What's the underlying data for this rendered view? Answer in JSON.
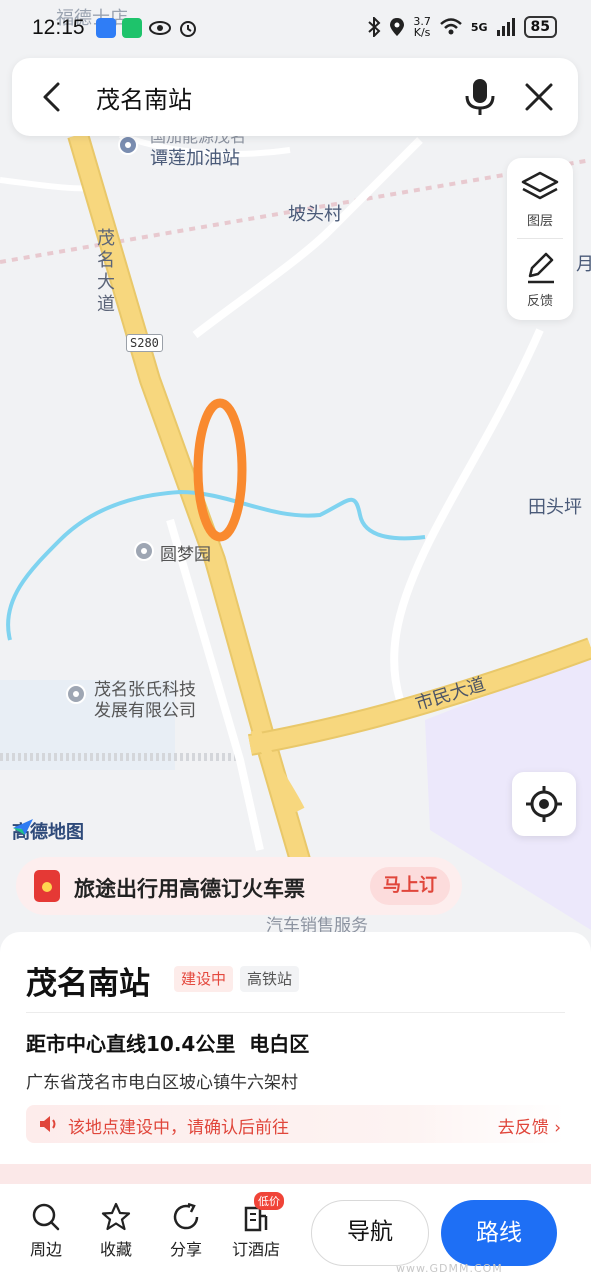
{
  "status_bar": {
    "time": "12:15",
    "speed_value": "3.7",
    "speed_unit": "K/s",
    "network": "5G",
    "battery": "85"
  },
  "search": {
    "query": "茂名南站"
  },
  "map": {
    "labels": {
      "gas_station_partial": "国加能源茂名",
      "gas_station": "谭莲加油站",
      "village_potou": "坡头村",
      "road_maoming_dadao": "茂名大道",
      "shield_s280": "S280",
      "poi_yuanmengyuan": "圆梦园",
      "village_tiantou": "田头坪",
      "poi_company_line1": "茂名张氏科技",
      "poi_company_line2": "发展有限公司",
      "road_shimin": "市民大道",
      "partial_service": "汽车销售服务",
      "top_partial": "福德士店",
      "edge_partial": "月"
    },
    "logo": "高德地图",
    "marker_color": "#f98a2f",
    "river_color": "#7fd3f0",
    "road_color": "#f7d77e"
  },
  "tools": {
    "layers": "图层",
    "feedback": "反馈"
  },
  "promo": {
    "text": "旅途出行用高德订火车票",
    "button": "马上订"
  },
  "poi": {
    "title": "茂名南站",
    "tag_status": "建设中",
    "tag_type": "高铁站",
    "distance": "距市中心直线10.4公里",
    "district": "电白区",
    "address": "广东省茂名市电白区坡心镇牛六架村",
    "warning": "该地点建设中，请确认后前往",
    "warning_link": "去反馈"
  },
  "bottom_bar": {
    "nearby": "周边",
    "favorite": "收藏",
    "share": "分享",
    "hotel": "订酒店",
    "hotel_badge": "低价",
    "navigate": "导航",
    "route": "路线"
  },
  "watermark": "www.GDMM.COM"
}
